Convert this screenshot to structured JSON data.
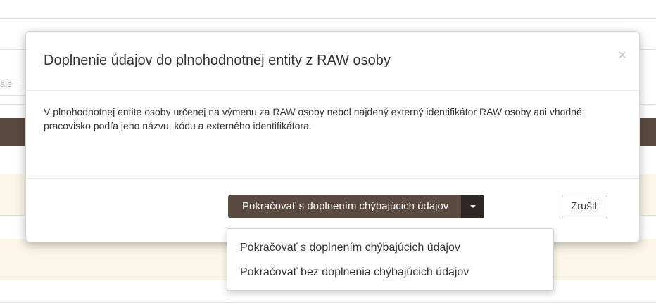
{
  "background": {
    "input_hint": "ale"
  },
  "modal": {
    "title": "Doplnenie údajov do plnohodnotnej entity z RAW osoby",
    "close_glyph": "×",
    "body_text": "V plnohodnotnej entite osoby určenej na výmenu za RAW osoby nebol najdený externý identifikátor RAW osoby ani vhodné pracovisko podľa jeho názvu, kódu a externého identifikátora.",
    "primary_button_label": "Pokračovať s doplnením chýbajúcich údajov",
    "cancel_button_label": "Zrušiť",
    "dropdown": {
      "items": [
        {
          "label": "Pokračovať s doplnením chýbajúcich údajov"
        },
        {
          "label": "Pokračovať bez doplnenia chýbajúcich údajov"
        }
      ]
    }
  },
  "colors": {
    "primary": "#5b4a40",
    "primary_dark": "#2e2622",
    "cream": "#fcf6e8"
  },
  "icons": {
    "close": "close-icon",
    "caret": "chevron-down-icon"
  }
}
